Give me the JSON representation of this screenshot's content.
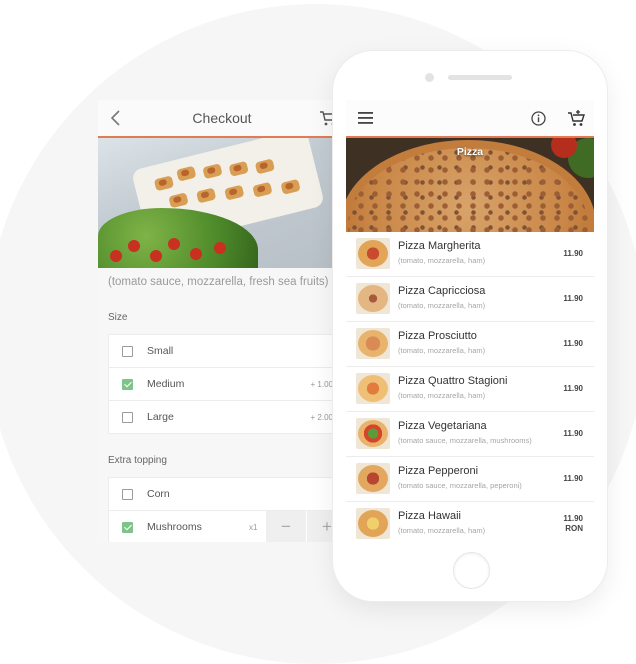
{
  "checkout": {
    "title": "Checkout",
    "description": "(tomato sauce, mozzarella, fresh sea fruits)",
    "size_label": "Size",
    "size_options": [
      {
        "label": "Small",
        "price": "",
        "checked": false
      },
      {
        "label": "Medium",
        "price": "+ 1.00",
        "checked": true
      },
      {
        "label": "Large",
        "price": "+ 2.00",
        "checked": false
      }
    ],
    "topping_label": "Extra topping",
    "topping_options": [
      {
        "label": "Corn",
        "checked": false
      },
      {
        "label": "Mushrooms",
        "checked": true,
        "qty": "x1",
        "minus": "−",
        "plus": "+"
      }
    ]
  },
  "menu": {
    "category_title": "Pizza",
    "currency": "RON",
    "items": [
      {
        "name": "Pizza Margherita",
        "desc": "(tomato, mozzarella, ham)",
        "price": "11.90"
      },
      {
        "name": "Pizza Capricciosa",
        "desc": "(tomato, mozzarella, ham)",
        "price": "11.90"
      },
      {
        "name": "Pizza Prosciutto",
        "desc": "(tomato, mozzarella, ham)",
        "price": "11.90"
      },
      {
        "name": "Pizza Quattro Stagioni",
        "desc": "(tomato, mozzarella, ham)",
        "price": "11.90"
      },
      {
        "name": "Pizza Vegetariana",
        "desc": "(tomato sauce, mozzarella, mushrooms)",
        "price": "11.90"
      },
      {
        "name": "Pizza Pepperoni",
        "desc": "(tomato sauce, mozzarella, peperoni)",
        "price": "11.90"
      },
      {
        "name": "Pizza Hawaii",
        "desc": "(tomato, mozzarella, ham)",
        "price": "11.90"
      }
    ]
  },
  "icons": {
    "back": "chevron-left-icon",
    "menu": "hamburger-menu-icon",
    "info": "info-icon",
    "cart": "cart-icon"
  },
  "colors": {
    "accent": "#e07b55",
    "check": "#7ec48a"
  }
}
